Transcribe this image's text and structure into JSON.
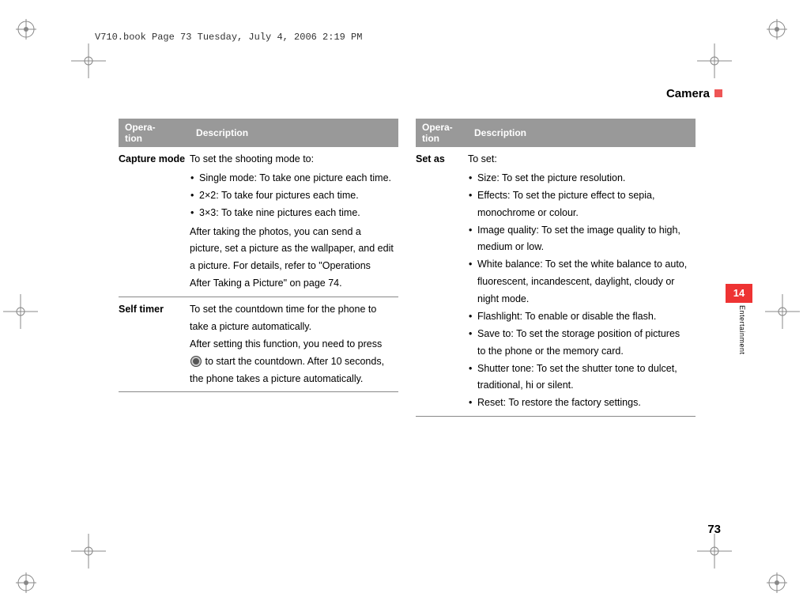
{
  "header": "V710.book  Page 73  Tuesday, July 4, 2006  2:19 PM",
  "section_title": "Camera",
  "side_tab": "14",
  "side_label": "Entertainment",
  "page_number": "73",
  "table_headers": {
    "operation": "Opera-\ntion",
    "description": "Description"
  },
  "left_table": [
    {
      "operation": "Capture mode",
      "intro": "To set the shooting mode to:",
      "bullets": [
        "Single mode: To take one picture each time.",
        "2×2: To take four pictures each time.",
        "3×3: To take nine pictures each time."
      ],
      "after": "After taking the photos, you can send a picture, set a picture as the wallpaper, and edit a picture. For details, refer to \"Operations After Taking a Picture\" on page 74."
    },
    {
      "operation": "Self timer",
      "line1": "To set the countdown time for the phone to take a picture automatically.",
      "line2a": "After setting this function, you need to press",
      "line2b": "to start the countdown. After 10 seconds, the phone takes a picture automatically."
    }
  ],
  "right_table": [
    {
      "operation": "Set as",
      "intro": "To set:",
      "bullets": [
        "Size: To set the picture resolution.",
        "Effects: To set the picture effect to sepia, monochrome or colour.",
        "Image quality: To set the image quality to high, medium or low.",
        "White balance: To set the white balance to auto, fluorescent, incandescent, daylight, cloudy or night mode.",
        "Flashlight: To enable or disable the flash.",
        "Save to: To set the storage position of pictures to the phone or the memory card.",
        "Shutter tone: To set the shutter tone to dulcet, traditional, hi or silent.",
        "Reset: To restore the factory settings."
      ]
    }
  ]
}
